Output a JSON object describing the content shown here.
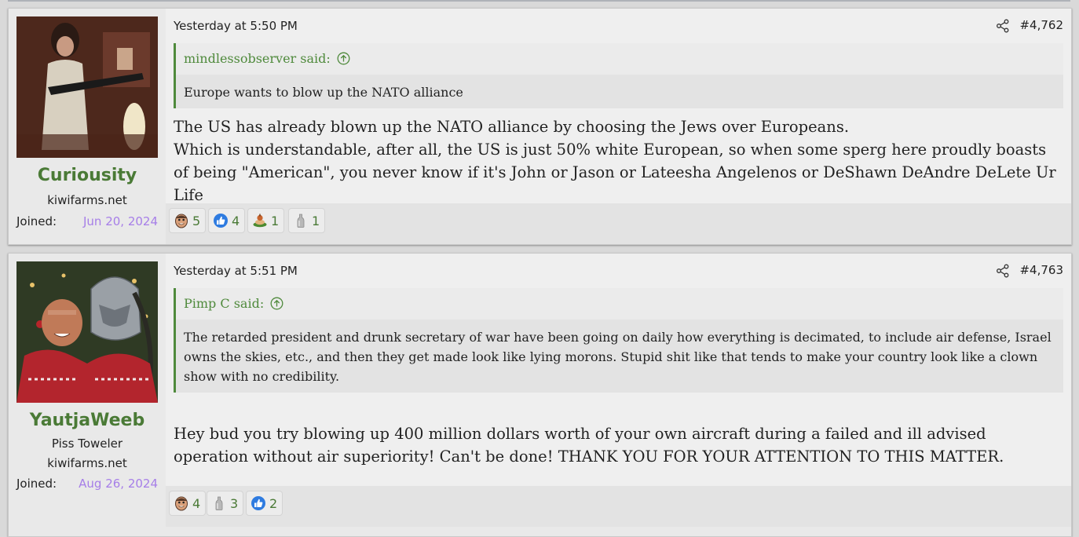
{
  "posts": [
    {
      "user": {
        "name": "Curiousity",
        "title": "",
        "site": "kiwifarms.net",
        "joined_label": "Joined:",
        "joined": "Jun 20, 2024"
      },
      "date": "Yesterday at 5:50 PM",
      "number": "#4,762",
      "quote": {
        "author": "mindlessobserver said:",
        "text": "Europe wants to blow up the NATO alliance"
      },
      "body": [
        "The US has already blown up the NATO alliance by choosing the Jews over Europeans.",
        "Which is understandable, after all, the US is just 50% white European, so when some sperg here proudly boasts of being \"American\", you never know if it's John or Jason or Lateesha Angelenos or DeShawn DeAndre DeLete Ur Life"
      ],
      "reactions": [
        {
          "icon": "face-emoji-icon",
          "count": "5"
        },
        {
          "icon": "thumbs-up-icon",
          "count": "4"
        },
        {
          "icon": "food-plate-icon",
          "count": "1"
        },
        {
          "icon": "glass-bottle-icon",
          "count": "1"
        }
      ]
    },
    {
      "user": {
        "name": "YautjaWeeb",
        "title": "Piss Toweler",
        "site": "kiwifarms.net",
        "joined_label": "Joined:",
        "joined": "Aug 26, 2024"
      },
      "date": "Yesterday at 5:51 PM",
      "number": "#4,763",
      "quote": {
        "author": "Pimp C said:",
        "text": "The retarded president and drunk secretary of war have been going on daily how everything is decimated, to include air defense, Israel owns the skies, etc., and then they get made look like lying morons. Stupid shit like that tends to make your country look like a clown show with no credibility."
      },
      "body": [
        "Hey bud you try blowing up 400 million dollars worth of your own aircraft during a failed and ill advised operation without air superiority! Can't be done! THANK YOU FOR YOUR ATTENTION TO THIS MATTER."
      ],
      "reactions": [
        {
          "icon": "face-emoji-icon",
          "count": "4"
        },
        {
          "icon": "glass-bottle-icon",
          "count": "3"
        },
        {
          "icon": "thumbs-up-icon",
          "count": "2"
        }
      ]
    }
  ],
  "colors": {
    "username": "#4a7a36",
    "joined_date": "#a67ee8",
    "quote_accent": "#4f8a3c",
    "reaction_count": "#4a7a36"
  }
}
